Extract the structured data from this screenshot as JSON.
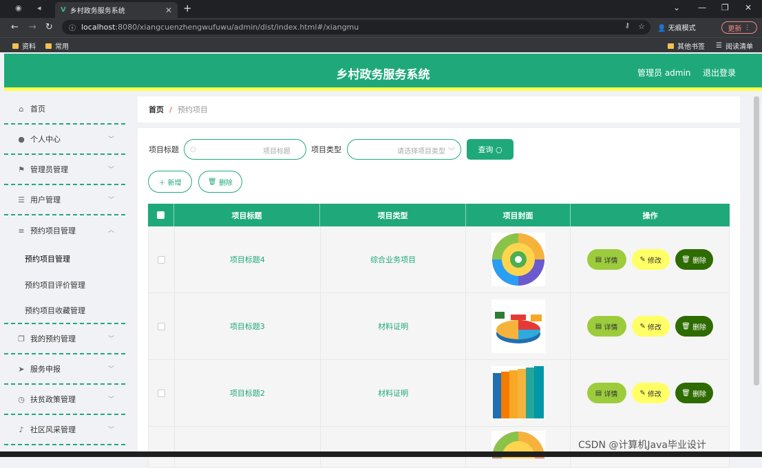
{
  "browser": {
    "tab_title": "乡村政务服务系统",
    "url_host": "localhost",
    "url_rest": ":8080/xiangcuenzhengwufuwu/admin/dist/index.html#/xiangmu",
    "incognito": "无痕模式",
    "update": "更新",
    "bookmarks": [
      "资料",
      "常用",
      "其他书签",
      "阅读清单"
    ]
  },
  "header": {
    "title": "乡村政务服务系统",
    "admin": "管理员 admin",
    "logout": "退出登录"
  },
  "sidebar": {
    "items": [
      {
        "label": "首页",
        "icon": "home-icon"
      },
      {
        "label": "个人中心",
        "icon": "user-icon"
      },
      {
        "label": "管理员管理",
        "icon": "flag-icon"
      },
      {
        "label": "用户管理",
        "icon": "sliders-icon"
      },
      {
        "label": "预约项目管理",
        "icon": "list-icon"
      },
      {
        "label": "我的预约管理",
        "icon": "copy-icon"
      },
      {
        "label": "服务申报",
        "icon": "send-icon"
      },
      {
        "label": "扶贫政策管理",
        "icon": "gauge-icon"
      },
      {
        "label": "社区风采管理",
        "icon": "bell-off-icon"
      }
    ],
    "sub_items": [
      "预约项目管理",
      "预约项目评价管理",
      "预约项目收藏管理"
    ]
  },
  "breadcrumb": {
    "home": "首页",
    "sep": "/",
    "current": "预约项目"
  },
  "search": {
    "title_label": "项目标题",
    "title_placeholder": "项目标题",
    "type_label": "项目类型",
    "type_placeholder": "请选择项目类型",
    "query": "查询"
  },
  "actions": {
    "add": "新增",
    "delete": "删除"
  },
  "table": {
    "headers": [
      "项目标题",
      "项目类型",
      "项目封面",
      "操作"
    ],
    "rows": [
      {
        "title": "项目标题4",
        "type": "综合业务项目",
        "cover": "wheel"
      },
      {
        "title": "项目标题3",
        "type": "材料证明",
        "cover": "pie"
      },
      {
        "title": "项目标题2",
        "type": "材料证明",
        "cover": "bars"
      }
    ],
    "btn_detail": "详情",
    "btn_edit": "修改",
    "btn_delete": "删除"
  },
  "watermark": "CSDN @计算机Java毕业设计",
  "colors": {
    "primary": "#1fa97a",
    "accent_stripe": "#ffff4d",
    "detail": "#9ccc3c",
    "edit": "#ffff66",
    "delete": "#2e6b00"
  }
}
